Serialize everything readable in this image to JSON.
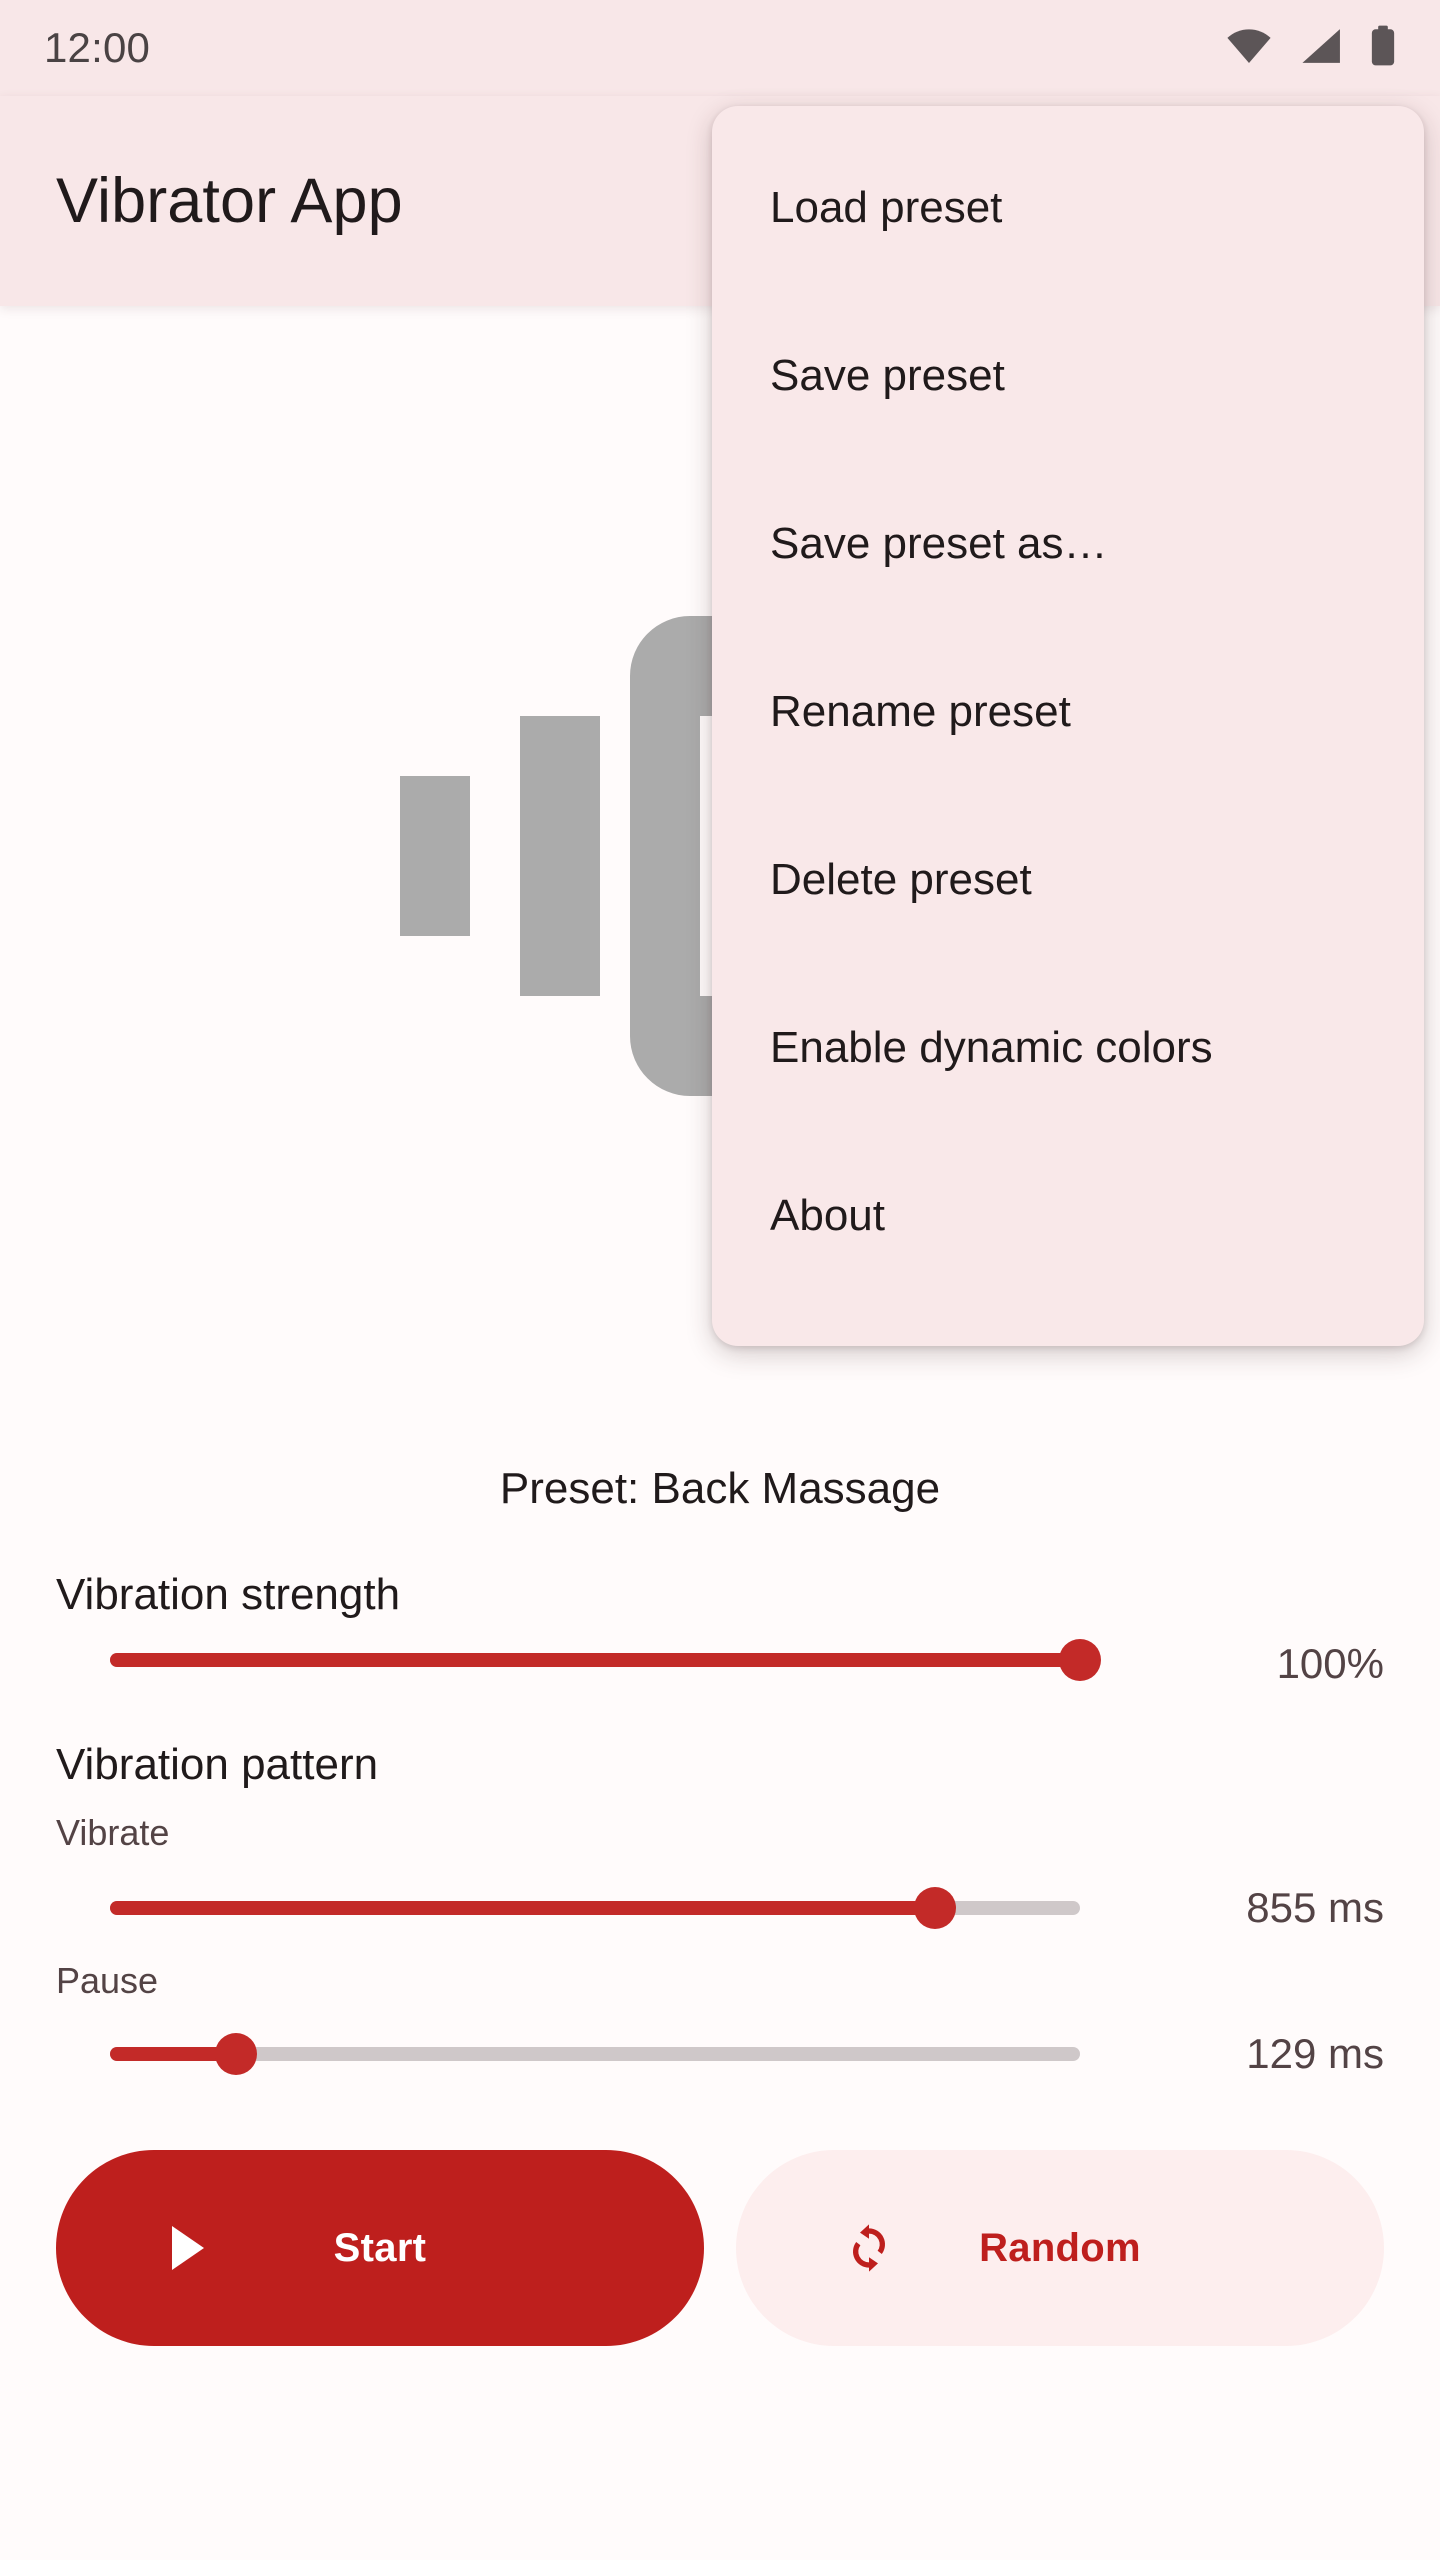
{
  "status_bar": {
    "clock": "12:00",
    "icons": [
      "wifi-icon",
      "cellular-signal-icon",
      "battery-icon"
    ]
  },
  "app_bar": {
    "title": "Vibrator App"
  },
  "illustration": {
    "icon": "vibration-icon",
    "color": "#ABABAB"
  },
  "overflow_menu": {
    "items": [
      {
        "label": "Load preset"
      },
      {
        "label": "Save preset"
      },
      {
        "label": "Save preset as…"
      },
      {
        "label": "Rename preset"
      },
      {
        "label": "Delete preset"
      },
      {
        "label": "Enable dynamic colors"
      },
      {
        "label": "About"
      }
    ]
  },
  "main": {
    "preset_label": "Preset: Back Massage",
    "strength": {
      "label": "Vibration strength",
      "value_text": "100%",
      "percent": 100
    },
    "pattern": {
      "label": "Vibration pattern",
      "vibrate": {
        "label": "Vibrate",
        "value_text": "855 ms",
        "percent": 85
      },
      "pause": {
        "label": "Pause",
        "value_text": "129 ms",
        "percent": 13
      }
    }
  },
  "buttons": {
    "start": {
      "label": "Start",
      "icon": "play-icon"
    },
    "random": {
      "label": "Random",
      "icon": "refresh-sync-icon"
    }
  },
  "colors": {
    "accent": "#BE1F1D",
    "app_bar_bg": "#F8E7E8",
    "menu_bg": "#F9E8E9",
    "page_bg": "#FFFBFB",
    "track_inactive": "#CFC8C9",
    "on_surface": "#201A1B",
    "on_surface_variant": "#534345"
  }
}
